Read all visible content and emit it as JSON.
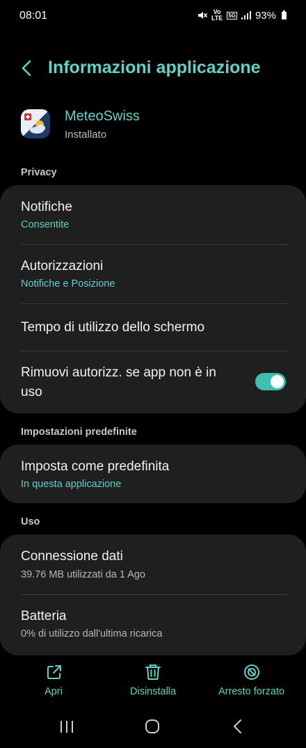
{
  "status_bar": {
    "time": "08:01",
    "network_top": "Vo",
    "network_bottom": "LTE",
    "network_5g": "5G",
    "battery": "93%"
  },
  "header": {
    "title": "Informazioni applicazione"
  },
  "app": {
    "name": "MeteoSwiss",
    "status": "Installato"
  },
  "sections": {
    "privacy": "Privacy",
    "defaults": "Impostazioni predefinite",
    "usage": "Uso"
  },
  "privacy_items": {
    "notifications_title": "Notifiche",
    "notifications_sub": "Consentite",
    "permissions_title": "Autorizzazioni",
    "permissions_sub": "Notifiche e Posizione",
    "screen_time_title": "Tempo di utilizzo dello schermo",
    "remove_permissions_line1": "Rimuovi autorizz. se app non è in",
    "remove_permissions_line2": "uso",
    "remove_permissions_enabled": true
  },
  "default_items": {
    "set_default_title": "Imposta come predefinita",
    "set_default_sub": "In questa applicazione"
  },
  "usage_items": {
    "data_title": "Connessione dati",
    "data_sub": "39.76 MB utilizzati da 1 Ago",
    "battery_title": "Batteria",
    "battery_sub": "0% di utilizzo dall'ultima ricarica"
  },
  "actions": {
    "open": "Apri",
    "uninstall": "Disinstalla",
    "force_stop": "Arresto forzato"
  },
  "colors": {
    "accent": "#5fd3c6",
    "background": "#000000",
    "card": "#1f1f1f"
  }
}
